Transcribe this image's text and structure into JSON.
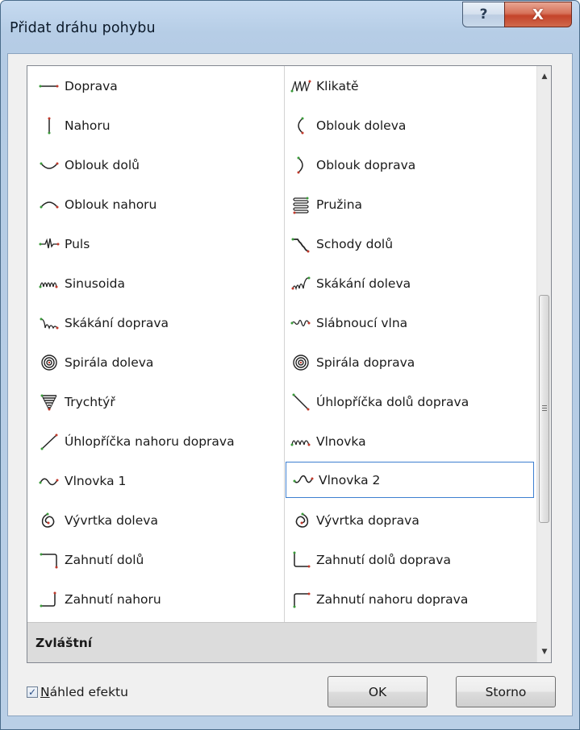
{
  "window": {
    "title": "Přidat dráhu pohybu",
    "help_label": "?",
    "close_label": "X"
  },
  "list": {
    "left_items": [
      {
        "label": "Doprava",
        "icon": "line-right-icon"
      },
      {
        "label": "Nahoru",
        "icon": "line-up-icon"
      },
      {
        "label": "Oblouk dolů",
        "icon": "arc-down-icon"
      },
      {
        "label": "Oblouk nahoru",
        "icon": "arc-up-icon"
      },
      {
        "label": "Puls",
        "icon": "pulse-icon"
      },
      {
        "label": "Sinusoida",
        "icon": "sine-loop-icon"
      },
      {
        "label": "Skákání doprava",
        "icon": "bounce-right-icon"
      },
      {
        "label": "Spirála doleva",
        "icon": "spiral-left-icon"
      },
      {
        "label": "Trychtýř",
        "icon": "funnel-icon"
      },
      {
        "label": "Úhlopříčka nahoru doprava",
        "icon": "diagonal-up-right-icon"
      },
      {
        "label": "Vlnovka 1",
        "icon": "wave-1-icon"
      },
      {
        "label": "Vývrtka doleva",
        "icon": "corkscrew-left-icon"
      },
      {
        "label": "Zahnutí dolů",
        "icon": "turn-down-icon"
      },
      {
        "label": "Zahnutí nahoru",
        "icon": "turn-up-icon"
      }
    ],
    "right_items": [
      {
        "label": "Klikatě",
        "icon": "zigzag-icon"
      },
      {
        "label": "Oblouk doleva",
        "icon": "arc-left-icon"
      },
      {
        "label": "Oblouk doprava",
        "icon": "arc-right-icon"
      },
      {
        "label": "Pružina",
        "icon": "spring-icon"
      },
      {
        "label": "Schody dolů",
        "icon": "stairs-down-icon"
      },
      {
        "label": "Skákání doleva",
        "icon": "bounce-left-icon"
      },
      {
        "label": "Slábnoucí vlna",
        "icon": "decaying-wave-icon"
      },
      {
        "label": "Spirála doprava",
        "icon": "spiral-right-icon"
      },
      {
        "label": "Úhlopříčka dolů doprava",
        "icon": "diagonal-down-right-icon"
      },
      {
        "label": "Vlnovka",
        "icon": "wavy-icon"
      },
      {
        "label": "Vlnovka 2",
        "icon": "wave-2-icon",
        "selected": true
      },
      {
        "label": "Vývrtka doprava",
        "icon": "corkscrew-right-icon"
      },
      {
        "label": "Zahnutí dolů doprava",
        "icon": "turn-down-right-icon"
      },
      {
        "label": "Zahnutí nahoru doprava",
        "icon": "turn-up-right-icon"
      }
    ],
    "section_header": "Zvláštní"
  },
  "footer": {
    "preview_checked": true,
    "preview_accel": "N",
    "preview_rest": "áhled efektu",
    "ok_label": "OK",
    "cancel_label": "Storno"
  },
  "colors": {
    "selection_border": "#3d7fd0",
    "path_start": "#3a9a3a",
    "path_end": "#c0392b"
  }
}
